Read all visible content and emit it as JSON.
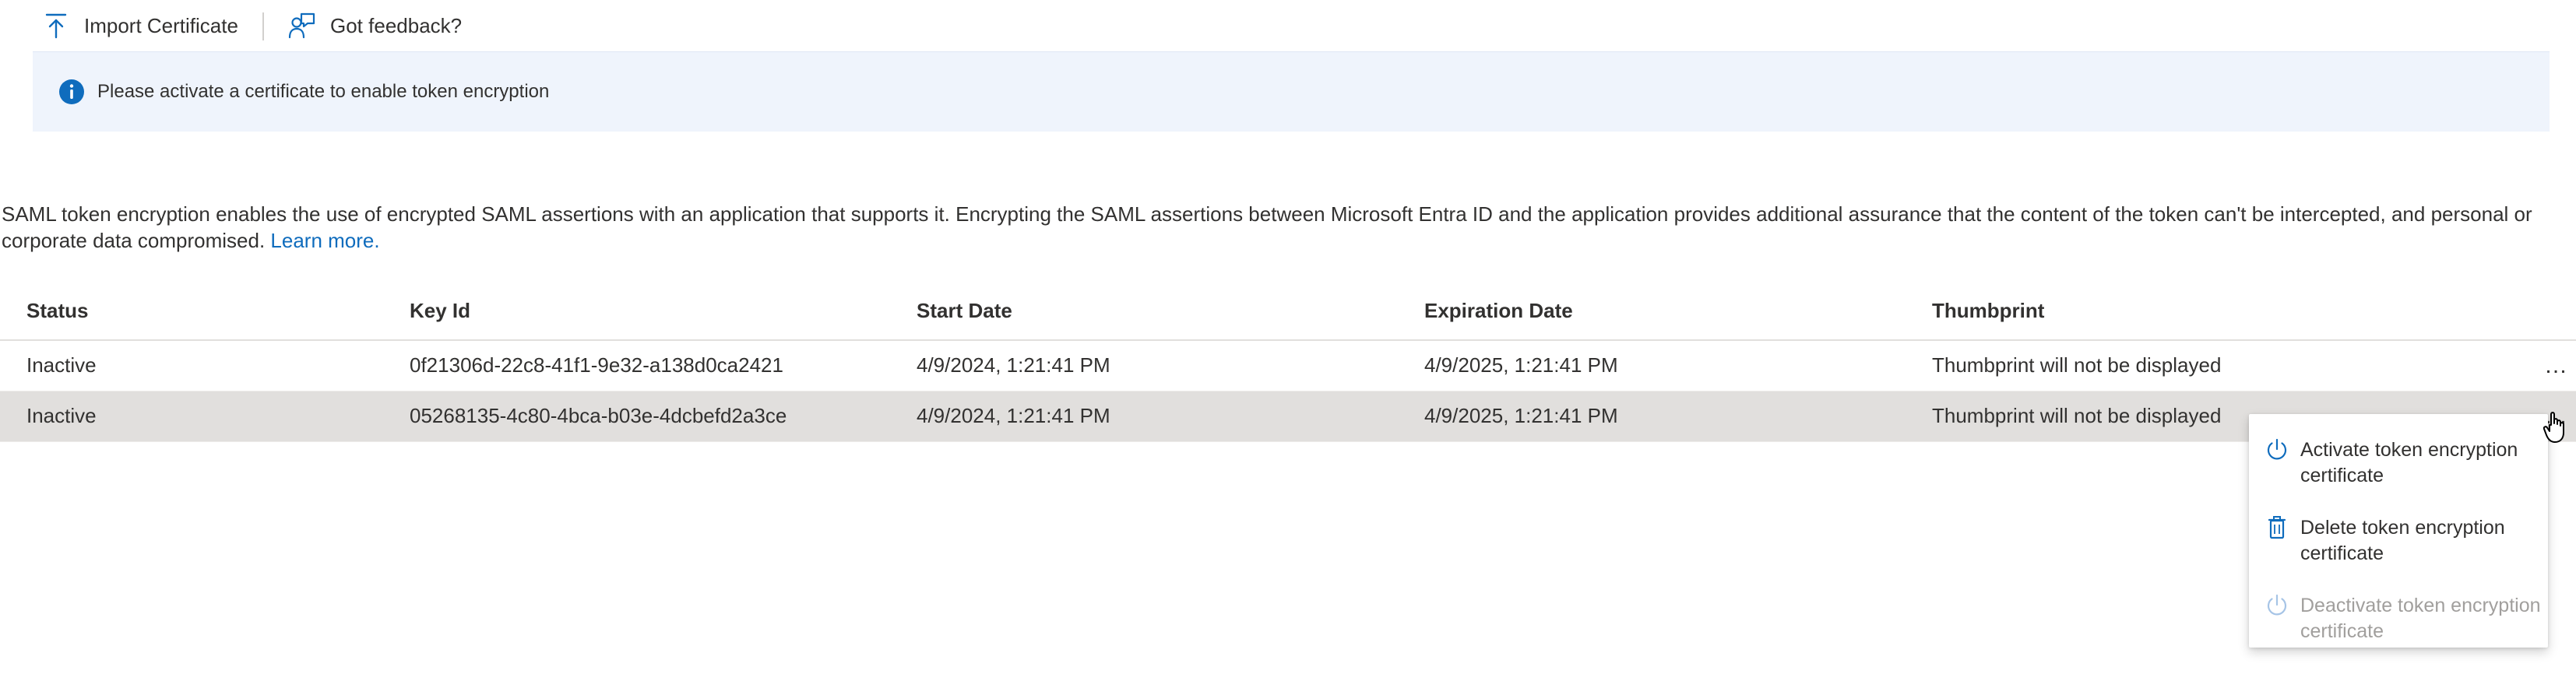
{
  "toolbar": {
    "import_label": "Import Certificate",
    "feedback_label": "Got feedback?"
  },
  "banner": {
    "message": "Please activate a certificate to enable token encryption",
    "icon": "info-icon"
  },
  "description": {
    "text": "SAML token encryption enables the use of encrypted SAML assertions with an application that supports it. Encrypting the SAML assertions between Microsoft Entra ID and the application provides additional assurance that the content of the token can't be intercepted, and personal or corporate data compromised.",
    "link": "Learn more."
  },
  "table": {
    "columns": {
      "status": "Status",
      "key_id": "Key Id",
      "start_date": "Start Date",
      "expiration_date": "Expiration Date",
      "thumbprint": "Thumbprint"
    },
    "rows": [
      {
        "status": "Inactive",
        "key_id": "0f21306d-22c8-41f1-9e32-a138d0ca2421",
        "start_date": "4/9/2024, 1:21:41 PM",
        "expiration_date": "4/9/2025, 1:21:41 PM",
        "thumbprint": "Thumbprint will not be displayed",
        "more": "…"
      },
      {
        "status": "Inactive",
        "key_id": "05268135-4c80-4bca-b03e-4dcbefd2a3ce",
        "start_date": "4/9/2024, 1:21:41 PM",
        "expiration_date": "4/9/2025, 1:21:41 PM",
        "thumbprint": "Thumbprint will not be displayed",
        "more": "…"
      }
    ]
  },
  "context_menu": {
    "items": [
      {
        "label": "Activate token encryption certificate",
        "icon": "power-icon",
        "disabled": false
      },
      {
        "label": "Delete token encryption certificate",
        "icon": "trash-icon",
        "disabled": false
      },
      {
        "label": "Deactivate token encryption certificate",
        "icon": "power-icon",
        "disabled": true
      }
    ]
  },
  "colors": {
    "accent": "#0f6cbd",
    "banner_bg": "#eff4fc",
    "selected_row": "#e1dfdd",
    "disabled_text": "#a19f9d"
  }
}
